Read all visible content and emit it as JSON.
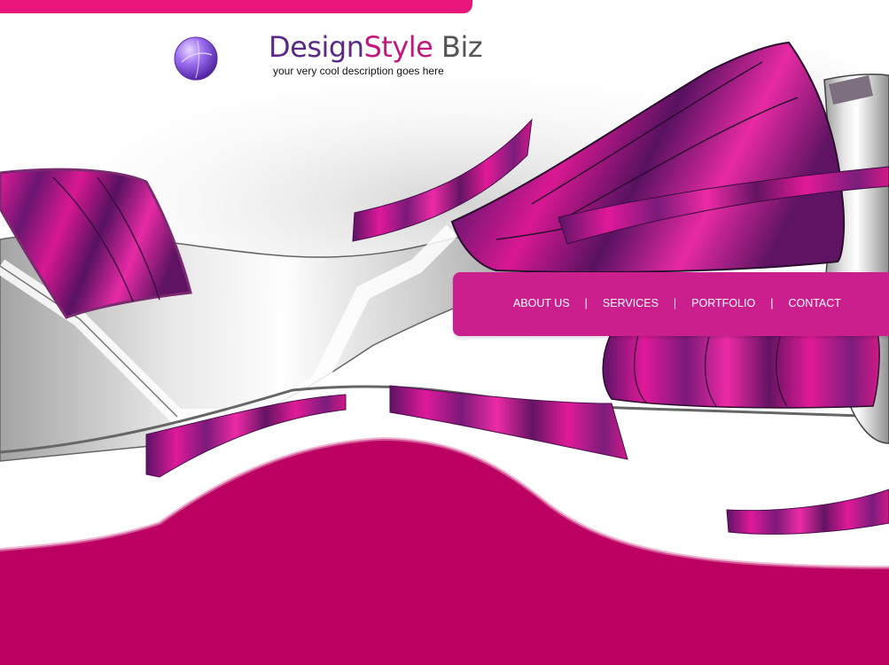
{
  "header": {
    "brand_word_1": "Design",
    "brand_word_2": "Style",
    "brand_word_3": "Biz",
    "tagline": "your very cool description goes here"
  },
  "nav": {
    "items": [
      {
        "label": "ABOUT US"
      },
      {
        "label": "SERVICES"
      },
      {
        "label": "PORTFOLIO"
      },
      {
        "label": "CONTACT"
      }
    ],
    "separator": "|"
  },
  "colors": {
    "accent_pink": "#e8157a",
    "nav_background": "#cc1f8e",
    "footer_magenta": "#bb0062",
    "brand_purple": "#5a2a86",
    "brand_pink": "#c2187d"
  },
  "icons": {
    "logo": "purple-orb-icon"
  }
}
